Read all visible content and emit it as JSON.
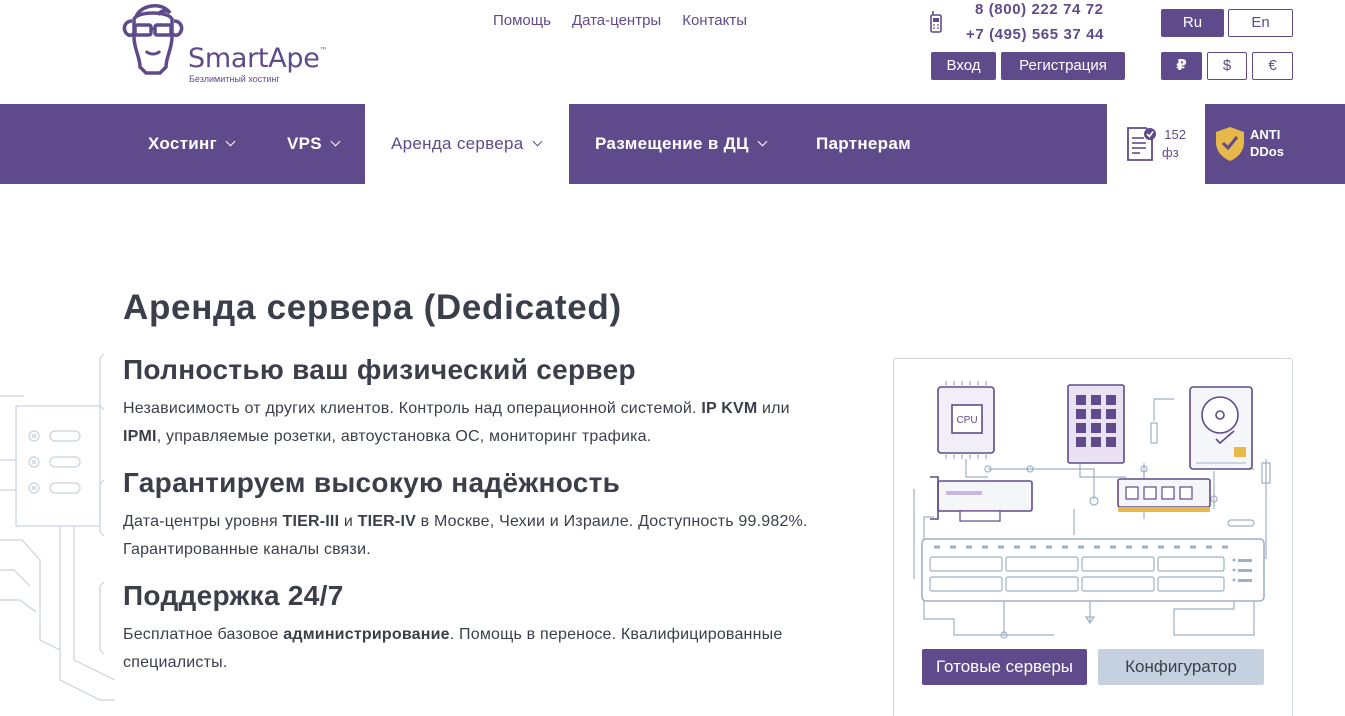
{
  "logo": {
    "name_smart": "Smart",
    "name_ape": "Ape",
    "tm": "™",
    "tagline": "Безлимитный хостинг"
  },
  "top_links": [
    "Помощь",
    "Дата-центры",
    "Контакты"
  ],
  "phones": [
    "8 (800) 222 74 72",
    "+7 (495) 565 37 44"
  ],
  "auth": {
    "login": "Вход",
    "register": "Регистрация"
  },
  "languages": {
    "ru": "Ru",
    "en": "En"
  },
  "currencies": {
    "rub": "₽",
    "usd": "$",
    "eur": "€"
  },
  "nav": {
    "items": [
      "Хостинг",
      "VPS",
      "Аренда сервера",
      "Размещение в ДЦ",
      "Партнерам"
    ],
    "active": "Аренда сервера"
  },
  "badges": {
    "fz_line1": "152",
    "fz_line2": "фз",
    "ddos_line1": "ANTI",
    "ddos_line2": "DDos"
  },
  "main": {
    "title": "Аренда сервера (Dedicated)",
    "features": [
      {
        "title": "Полностью ваш физический сервер",
        "text_a": "Независимость от других клиентов. Контроль над операционной системой. ",
        "bold_a": "IP KVM",
        "text_b": " или ",
        "bold_b": "IPMI",
        "text_c": ", управляемые розетки, автоустановка ОС, мониторинг трафика."
      },
      {
        "title": "Гарантируем высокую надёжность",
        "text_a": "Дата-центры уровня ",
        "bold_a": "TIER-III",
        "text_b": " и ",
        "bold_b": "TIER-IV",
        "text_c": " в Москве, Чехии и Израиле. Доступность 99.982%. Гарантированные каналы связи."
      },
      {
        "title": "Поддержка 24/7",
        "text_a": "Бесплатное базовое ",
        "bold_a": "администрирование",
        "text_b": ". Помощь в переносе. Квалифицированные специалисты."
      }
    ]
  },
  "illustration": {
    "cpu_label": "CPU"
  },
  "cta": {
    "ready": "Готовые серверы",
    "configurator": "Конфигуратор"
  },
  "colors": {
    "brand": "#5f4b8b",
    "text": "#3b3f4a",
    "secondary_button": "#c5d1de",
    "line": "#9fb0c4"
  }
}
